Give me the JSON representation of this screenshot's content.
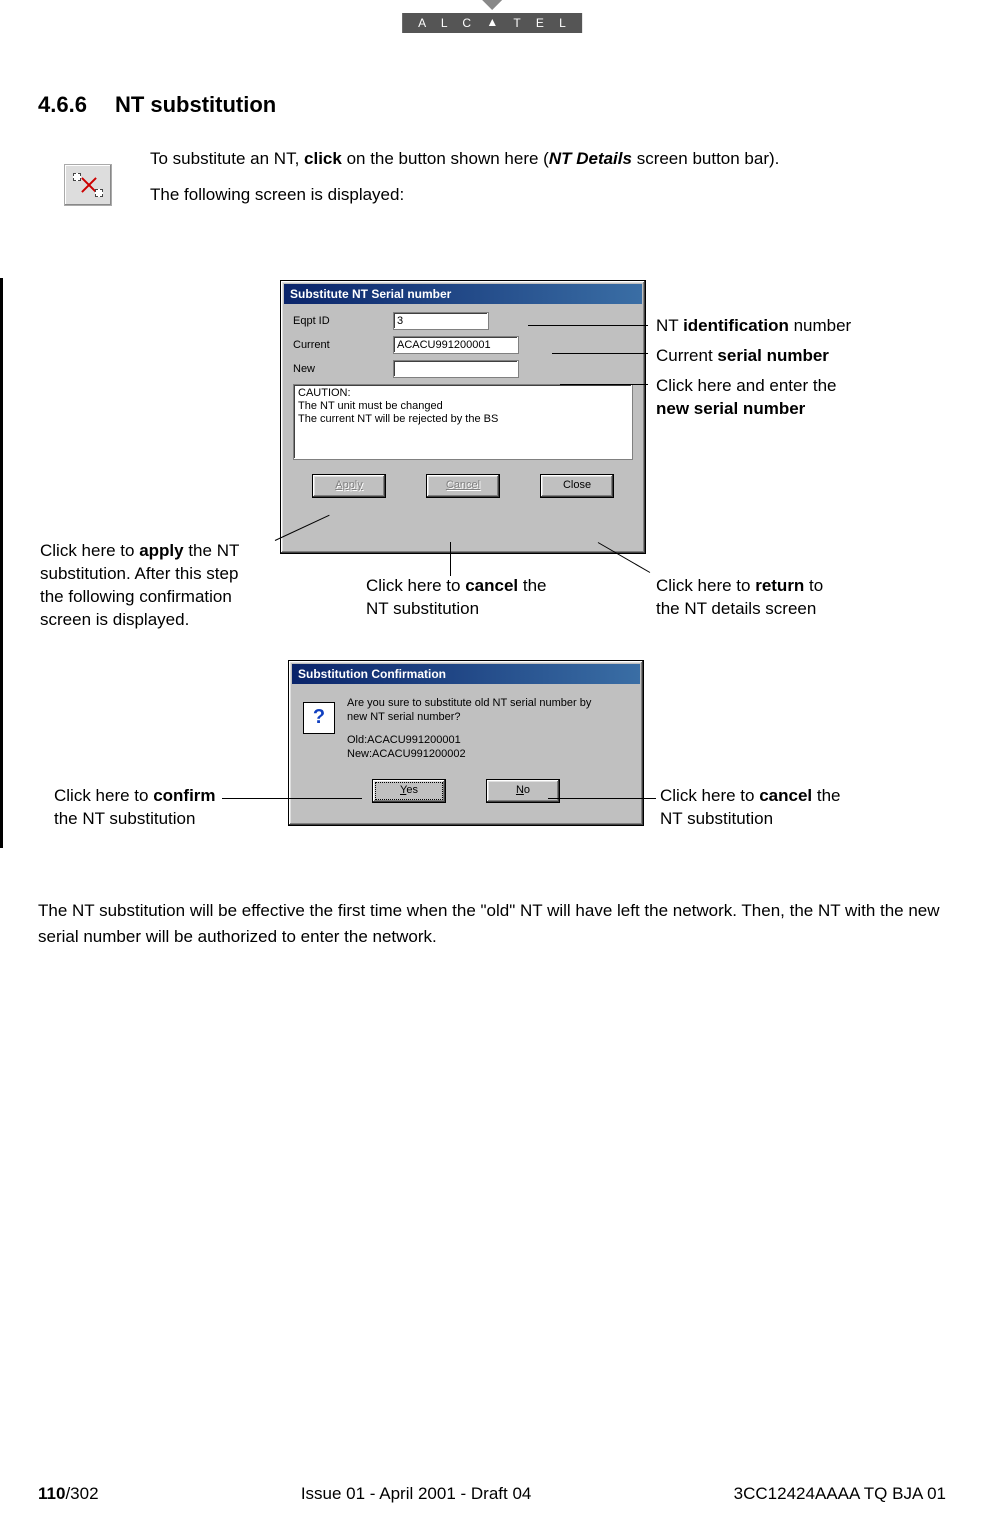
{
  "brand": {
    "text": "ALCATEL"
  },
  "heading": {
    "number": "4.6.6",
    "title": "NT substitution"
  },
  "intro": {
    "p1_pre": "To substitute an NT, ",
    "p1_b1": "click",
    "p1_mid": " on the button shown here (",
    "p1_bi": "NT Details",
    "p1_post": " screen button bar).",
    "p2": "The following screen is displayed:"
  },
  "dialog1": {
    "title": "Substitute NT Serial number",
    "labels": {
      "eqpt": "Eqpt ID",
      "current": "Current",
      "new": "New"
    },
    "values": {
      "eqpt": "3",
      "current": "ACACU991200001",
      "new": ""
    },
    "caution": {
      "l1": "CAUTION:",
      "l2": "The NT unit must be changed",
      "l3": "The current NT will be rejected by the BS"
    },
    "buttons": {
      "apply": "Apply",
      "cancel": "Cancel",
      "close": "Close"
    }
  },
  "callouts1": {
    "id_pre": "NT ",
    "id_b": "identification",
    "id_post": " number",
    "curr_pre": "Current ",
    "curr_b": "serial number",
    "new_l1": "Click here and enter the",
    "new_b": "new serial number",
    "apply_l1_pre": "Click here to ",
    "apply_l1_b": "apply",
    "apply_l1_post": " the NT",
    "apply_l2": "substitution. After this step",
    "apply_l3": "the following confirmation",
    "apply_l4": "screen is displayed.",
    "cancel_pre": "Click here to ",
    "cancel_b": "cancel",
    "cancel_post": " the",
    "cancel_l2": "NT substitution",
    "close_pre": "Click here to ",
    "close_b": "return",
    "close_post": " to",
    "close_l2": "the NT details screen"
  },
  "dialog2": {
    "title": "Substitution Confirmation",
    "msg_l1": "Are you sure to substitute old NT serial number by",
    "msg_l2": "new NT serial number?",
    "old": "Old:ACACU991200001",
    "new": "New:ACACU991200002",
    "buttons": {
      "yes": "Yes",
      "no": "No"
    }
  },
  "callouts2": {
    "yes_pre": "Click here to ",
    "yes_b": "confirm",
    "yes_l2": "the NT substitution",
    "no_pre": "Click here to ",
    "no_b": "cancel",
    "no_post": " the",
    "no_l2": "NT substitution"
  },
  "closing": "The NT substitution will be effective the first time when the \"old\" NT will have left the network. Then, the NT with the new serial number will be authorized to enter the network.",
  "footer": {
    "page_bold": "110",
    "page_rest": "/302",
    "center": "Issue 01 - April 2001 - Draft 04",
    "right": "3CC12424AAAA TQ BJA 01"
  }
}
